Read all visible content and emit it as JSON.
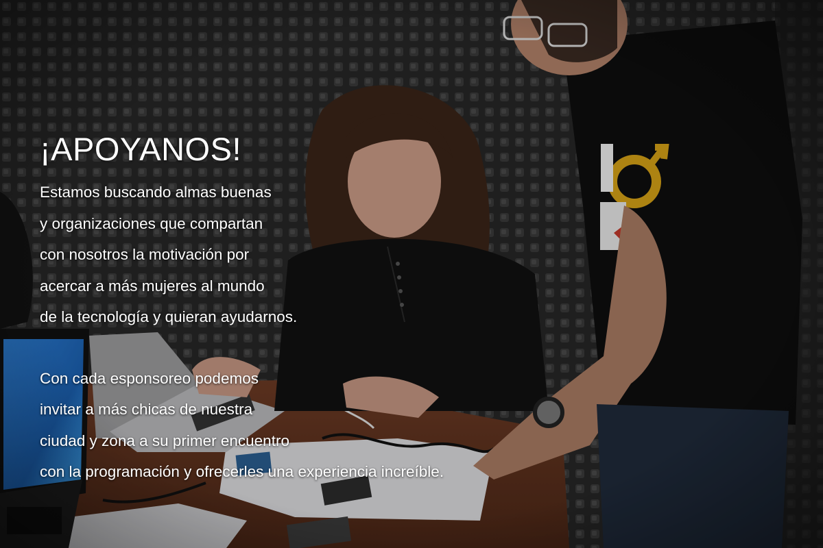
{
  "banner": {
    "headline": "¡APOYANOS!",
    "paragraph1": [
      "Estamos buscando almas buenas",
      "y organizaciones que compartan",
      "con nosotros la motivación por",
      "acercar a más mujeres al mundo",
      "de la tecnología y quieran ayudarnos."
    ],
    "paragraph2": [
      "Con cada esponsoreo podemos",
      "invitar a más chicas de nuestra",
      "ciudad y zona a su primer encuentro",
      "con la programación y ofrecerles una experiencia increíble."
    ],
    "colors": {
      "text": "#ffffff",
      "shirt_accent": "#d4a017",
      "background_wall": "#2a2a2a"
    }
  }
}
